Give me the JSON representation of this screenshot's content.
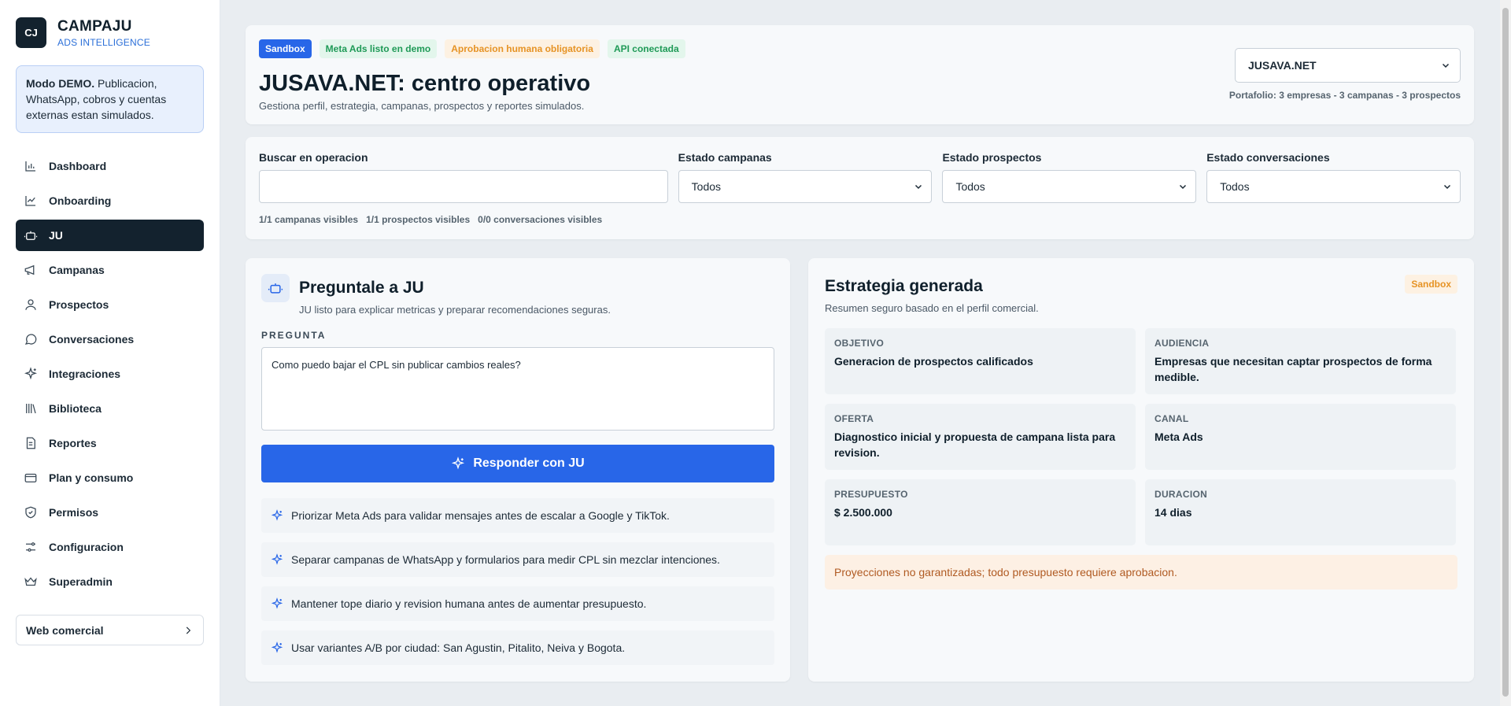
{
  "brand": {
    "logo": "CJ",
    "name": "CAMPAJU",
    "sub": "ADS INTELLIGENCE"
  },
  "demo": {
    "bold": "Modo DEMO.",
    "text": " Publicacion, WhatsApp, cobros y cuentas externas estan simulados."
  },
  "nav": [
    {
      "label": "Dashboard",
      "icon": "chart-icon"
    },
    {
      "label": "Onboarding",
      "icon": "onboarding-icon"
    },
    {
      "label": "JU",
      "icon": "robot-icon",
      "active": true
    },
    {
      "label": "Campanas",
      "icon": "megaphone-icon"
    },
    {
      "label": "Prospectos",
      "icon": "user-icon"
    },
    {
      "label": "Conversaciones",
      "icon": "chat-icon"
    },
    {
      "label": "Integraciones",
      "icon": "sparkle-icon"
    },
    {
      "label": "Biblioteca",
      "icon": "library-icon"
    },
    {
      "label": "Reportes",
      "icon": "report-icon"
    },
    {
      "label": "Plan y consumo",
      "icon": "card-icon"
    },
    {
      "label": "Permisos",
      "icon": "shield-icon"
    },
    {
      "label": "Configuracion",
      "icon": "sliders-icon"
    },
    {
      "label": "Superadmin",
      "icon": "crown-icon"
    }
  ],
  "web_button": "Web comercial",
  "header": {
    "badges": [
      "Sandbox",
      "Meta Ads listo en demo",
      "Aprobacion humana obligatoria",
      "API conectada"
    ],
    "title": "JUSAVA.NET: centro operativo",
    "subtitle": "Gestiona perfil, estrategia, campanas, prospectos y reportes simulados.",
    "company": "JUSAVA.NET",
    "portfolio": "Portafolio: 3 empresas - 3 campanas - 3 prospectos"
  },
  "filters": {
    "search_label": "Buscar en operacion",
    "search_value": "",
    "campaigns_label": "Estado campanas",
    "campaigns_value": "Todos",
    "prospects_label": "Estado prospectos",
    "prospects_value": "Todos",
    "conversations_label": "Estado conversaciones",
    "conversations_value": "Todos",
    "counts": [
      "1/1 campanas visibles",
      "1/1 prospectos visibles",
      "0/0 conversaciones visibles"
    ]
  },
  "ask": {
    "title": "Preguntale a JU",
    "subtitle": "JU listo para explicar metricas y preparar recomendaciones seguras.",
    "question_label": "PREGUNTA",
    "question": "Como puedo bajar el CPL sin publicar cambios reales?",
    "button": "Responder con JU",
    "suggestions": [
      "Priorizar Meta Ads para validar mensajes antes de escalar a Google y TikTok.",
      "Separar campanas de WhatsApp y formularios para medir CPL sin mezclar intenciones.",
      "Mantener tope diario y revision humana antes de aumentar presupuesto.",
      "Usar variantes A/B por ciudad: San Agustin, Pitalito, Neiva y Bogota."
    ]
  },
  "strategy": {
    "title": "Estrategia generada",
    "subtitle": "Resumen seguro basado en el perfil comercial.",
    "tag": "Sandbox",
    "cells": [
      {
        "k": "OBJETIVO",
        "v": "Generacion de prospectos calificados"
      },
      {
        "k": "AUDIENCIA",
        "v": "Empresas que necesitan captar prospectos de forma medible."
      },
      {
        "k": "OFERTA",
        "v": "Diagnostico inicial y propuesta de campana lista para revision."
      },
      {
        "k": "CANAL",
        "v": "Meta Ads"
      },
      {
        "k": "PRESUPUESTO",
        "v": "$ 2.500.000"
      },
      {
        "k": "DURACION",
        "v": "14 dias"
      }
    ],
    "warning": "Proyecciones no garantizadas; todo presupuesto requiere aprobacion."
  },
  "colors": {
    "accent": "#2866e8",
    "dark": "#13222e",
    "warning": "#e69325"
  }
}
